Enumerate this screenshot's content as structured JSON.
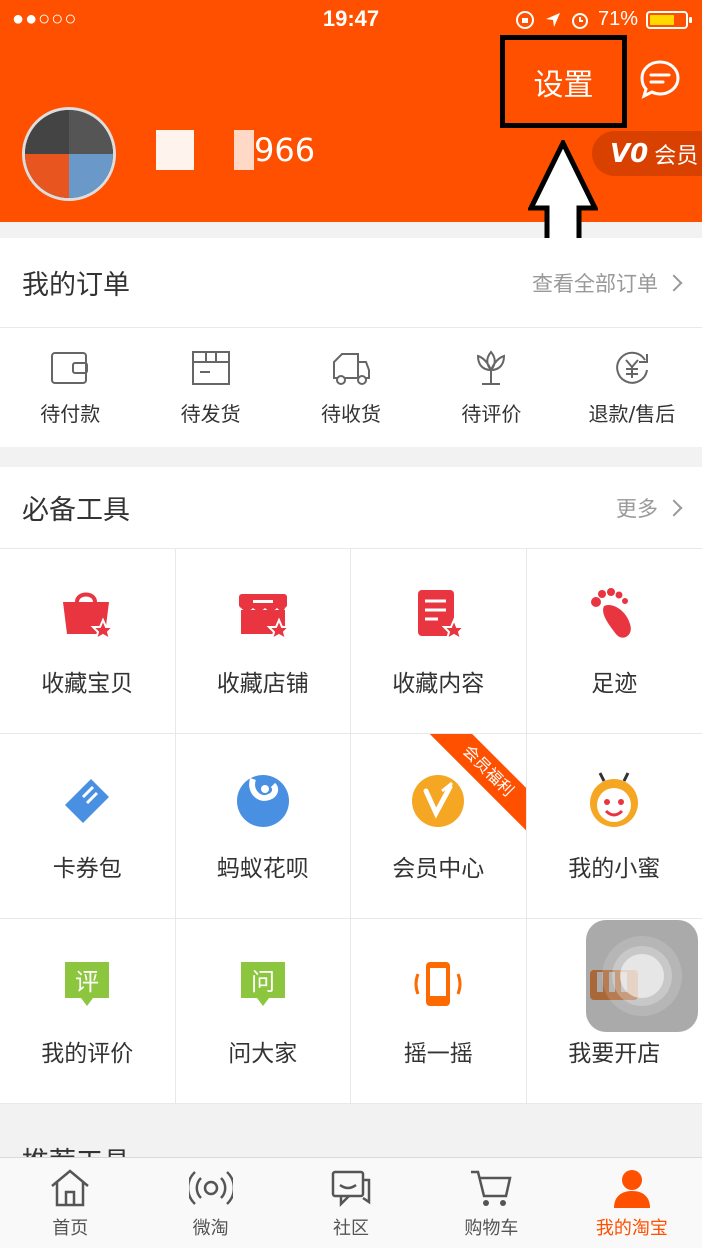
{
  "status_bar": {
    "time": "19:47",
    "battery_pct": "71%",
    "battery_level": 0.71,
    "signal": "●●○○○"
  },
  "header": {
    "settings_label": "设置",
    "username_visible": "966",
    "member_badge": {
      "level": "V0",
      "label": "会员"
    }
  },
  "orders": {
    "title": "我的订单",
    "more_label": "查看全部订单",
    "items": [
      {
        "label": "待付款",
        "icon": "wallet-icon"
      },
      {
        "label": "待发货",
        "icon": "package-icon"
      },
      {
        "label": "待收货",
        "icon": "truck-icon"
      },
      {
        "label": "待评价",
        "icon": "flower-icon"
      },
      {
        "label": "退款/售后",
        "icon": "refund-icon"
      }
    ]
  },
  "tools": {
    "title": "必备工具",
    "more_label": "更多",
    "items": [
      {
        "label": "收藏宝贝",
        "icon": "favorite-item-icon"
      },
      {
        "label": "收藏店铺",
        "icon": "favorite-shop-icon"
      },
      {
        "label": "收藏内容",
        "icon": "favorite-content-icon"
      },
      {
        "label": "足迹",
        "icon": "footprint-icon"
      },
      {
        "label": "卡券包",
        "icon": "coupon-icon"
      },
      {
        "label": "蚂蚁花呗",
        "icon": "huabei-icon"
      },
      {
        "label": "会员中心",
        "icon": "member-center-icon",
        "ribbon": "会员福利"
      },
      {
        "label": "我的小蜜",
        "icon": "assistant-bee-icon"
      },
      {
        "label": "我的评价",
        "icon": "review-icon",
        "glyph": "评"
      },
      {
        "label": "问大家",
        "icon": "ask-icon",
        "glyph": "问"
      },
      {
        "label": "摇一摇",
        "icon": "shake-phone-icon"
      },
      {
        "label": "我要开店",
        "icon": "open-shop-icon"
      }
    ]
  },
  "recommended": {
    "title": "推荐工具"
  },
  "tabbar": {
    "items": [
      {
        "label": "首页",
        "icon": "home-icon"
      },
      {
        "label": "微淘",
        "icon": "broadcast-icon"
      },
      {
        "label": "社区",
        "icon": "chat-icon"
      },
      {
        "label": "购物车",
        "icon": "cart-icon"
      },
      {
        "label": "我的淘宝",
        "icon": "profile-icon",
        "active": true
      }
    ]
  },
  "colors": {
    "brand": "#ff5000",
    "red_icon": "#e8353f",
    "blue_icon": "#4a90e2",
    "green_icon": "#8cc63f"
  }
}
